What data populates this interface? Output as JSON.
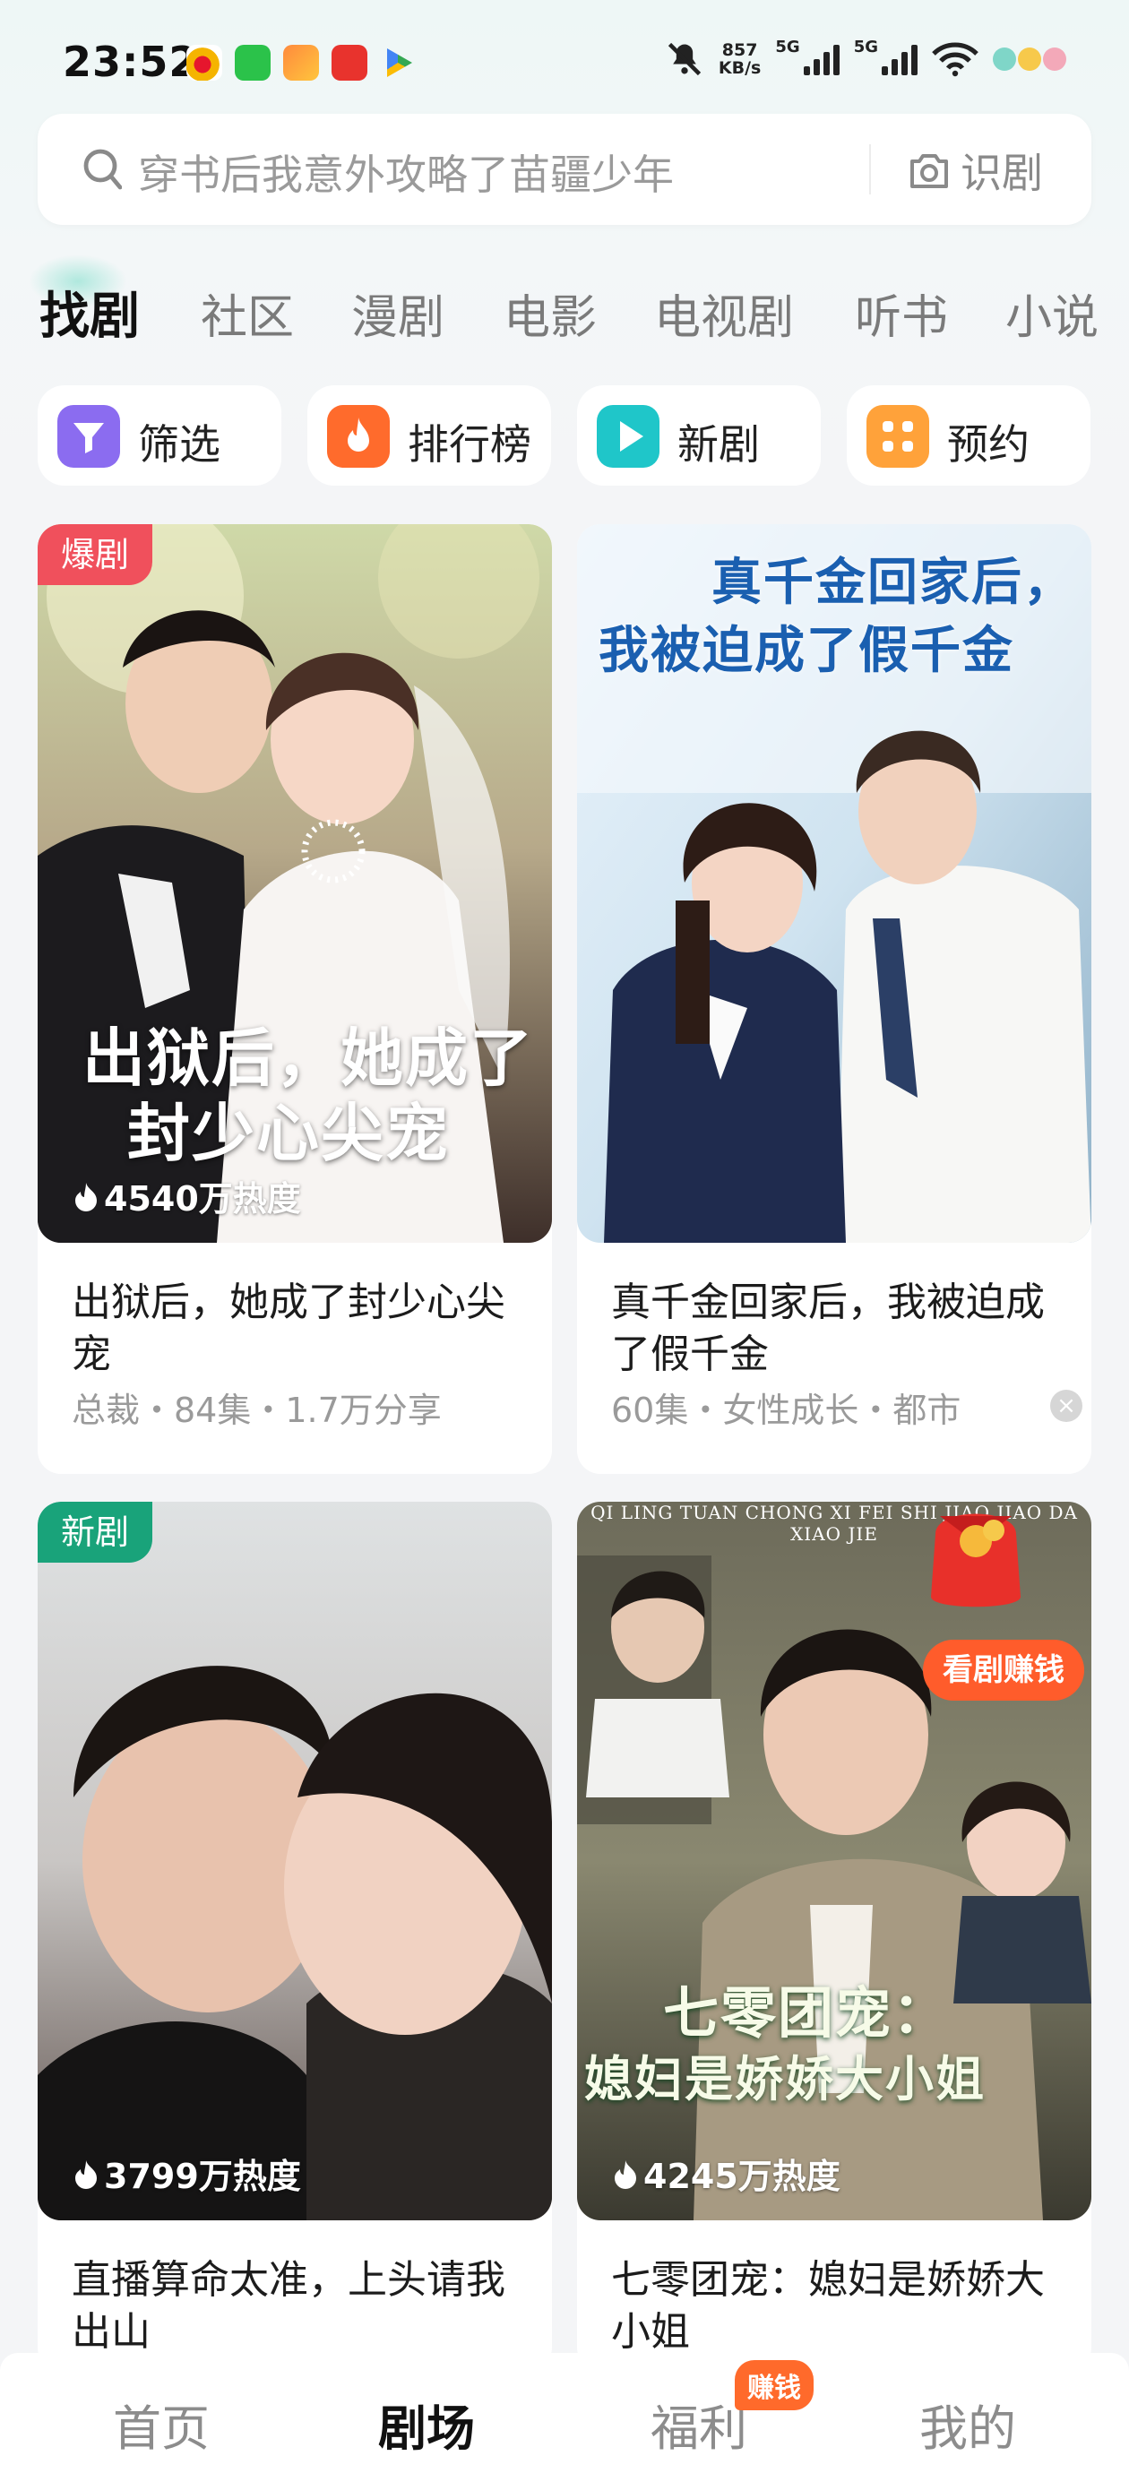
{
  "status_bar": {
    "time": "23:52",
    "net_speed_value": "857",
    "net_speed_unit": "KB/s",
    "signal1_label": "5G",
    "signal2_label": "5G",
    "icons": [
      "weibo-icon",
      "wechat-icon",
      "video-app-icon",
      "red-app-icon",
      "play-store-icon",
      "mute-icon",
      "signal-icon",
      "signal-icon",
      "wifi-icon",
      "battery-toys-icon"
    ]
  },
  "search": {
    "placeholder": "穿书后我意外攻略了苗疆少年",
    "recognize_label": "识剧"
  },
  "tabs": [
    {
      "label": "找剧",
      "active": true
    },
    {
      "label": "社区"
    },
    {
      "label": "漫剧"
    },
    {
      "label": "电影"
    },
    {
      "label": "电视剧"
    },
    {
      "label": "听书"
    },
    {
      "label": "小说"
    }
  ],
  "quick_actions": [
    {
      "label": "筛选",
      "icon": "filter-icon",
      "color": "#8b6cf0"
    },
    {
      "label": "排行榜",
      "icon": "flame-icon",
      "color": "#ff6b2c"
    },
    {
      "label": "新剧",
      "icon": "play-icon",
      "color": "#1fc6c9"
    },
    {
      "label": "预约",
      "icon": "grid-dots-icon",
      "color": "#ffa23a"
    }
  ],
  "cards": [
    {
      "tag": "爆剧",
      "poster_title_line1": "出狱后，她成了",
      "poster_title_line2": "封少心尖宠",
      "heat": "4540万热度",
      "title": "出狱后，她成了封少心尖宠",
      "meta": "总裁・84集・1.7万分享"
    },
    {
      "poster_title_line1": "真千金回家后，",
      "poster_title_line2": "我被迫成了假千金",
      "title": "真千金回家后，我被迫成了假千金",
      "meta": "60集・女性成长・都市"
    },
    {
      "tag": "新剧",
      "heat": "3799万热度",
      "title": "直播算命太准，上头请我出山"
    },
    {
      "badge": "看剧赚钱",
      "poster_top_text": "QI LING TUAN CHONG XI FEI SHI JIAO JIAO DA XIAO JIE",
      "poster_title_line1": "七零团宠：",
      "poster_title_line2": "媳妇是娇娇大小姐",
      "heat": "4245万热度",
      "title": "七零团宠：媳妇是娇娇大小姐"
    }
  ],
  "bottom_nav": [
    {
      "label": "首页"
    },
    {
      "label": "剧场",
      "active": true
    },
    {
      "label": "福利",
      "badge": "赚钱"
    },
    {
      "label": "我的"
    }
  ]
}
